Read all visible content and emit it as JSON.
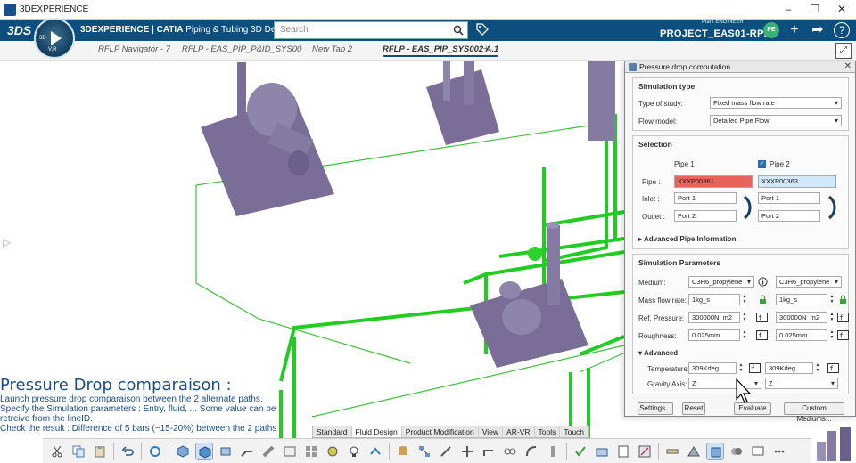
{
  "window": {
    "title": "3DEXPERIENCE"
  },
  "appbar": {
    "logo": "3DS",
    "title_brand": "3DEXPERIENCE | CATIA",
    "title_app": "Piping & Tubing 3D Design",
    "search_placeholder": "Search",
    "plant_label": "Plant ENGINEER",
    "project": "PROJECT_EAS01-RPE",
    "avatar_initials": "PE",
    "compass_label_3d": "3D",
    "compass_label_vr": "V,R",
    "icons": [
      "search-icon",
      "tag-icon",
      "add-icon",
      "share-icon",
      "help-icon"
    ]
  },
  "tabs": [
    {
      "label": "RFLP Navigator - 7"
    },
    {
      "label": "RFLP - EAS_PIP_P&ID_SYS00"
    },
    {
      "label": "New Tab 2"
    },
    {
      "label": "RFLP - EAS_PIP_SYS002 A.1"
    }
  ],
  "caption": {
    "title": "Pressure Drop comparaison :",
    "lines": [
      "Launch pressure drop comparaison between the 2 alternate paths.",
      "Specify the Simulation parameters : Entry, fluid, ... Some value can be",
      "retreive from the lineID.",
      "Check the result : Difference of 5 bars (~15-20%) between the 2 paths"
    ]
  },
  "section_tabs": [
    "Standard",
    "Fluid Design",
    "Product Modification",
    "View",
    "AR-VR",
    "Tools",
    "Touch"
  ],
  "panel": {
    "title": "Pressure drop computation",
    "simulation_type": {
      "heading": "Simulation type",
      "type_label": "Type of study:",
      "type_value": "Fixed mass flow rate",
      "model_label": "Flow model:",
      "model_value": "Detailed Pipe Flow"
    },
    "selection": {
      "heading": "Selection",
      "pipe1_label": "Pipe 1",
      "pipe2_label": "Pipe 2",
      "pipe_label": "Pipe :",
      "pipe1_value": "XXXP00361",
      "pipe2_value": "XXXP00363",
      "inlet_label": "Inlet :",
      "outlet_label": "Outlet :",
      "inlet1": "Port 1",
      "inlet2": "Port 1",
      "outlet1": "Port 2",
      "outlet2": "Port 2",
      "advanced_pipe": "Advanced Pipe Information"
    },
    "parameters": {
      "heading": "Simulation Parameters",
      "medium_label": "Medium:",
      "medium1": "C3H6_propylene",
      "medium2": "C3H6_propylene",
      "mass_flow_label": "Mass flow rate:",
      "mass_flow1": "1kg_s",
      "mass_flow2": "1kg_s",
      "ref_pressure_label": "Ref. Pressure:",
      "ref_pressure1": "300000N_m2",
      "ref_pressure2": "300000N_m2",
      "roughness_label": "Roughness:",
      "roughness1": "0.025mm",
      "roughness2": "0.025mm",
      "advanced_heading": "Advanced",
      "temperature_label": "Temperature:",
      "temperature1": "309Kdeg",
      "temperature2": "309Kdeg",
      "gravity_label": "Gravity Axis:",
      "gravity1": "Z",
      "gravity2": "Z"
    },
    "buttons": {
      "settings": "Settings...",
      "reset": "Reset",
      "evaluate": "Evaluate",
      "custom": "Custom Mediums..."
    },
    "colors": {
      "pipe1_bg": "#e8645a",
      "pipe2_bg": "#cfe8fb",
      "accent": "#0c4f7e",
      "pipe_green": "#22cc22"
    }
  }
}
